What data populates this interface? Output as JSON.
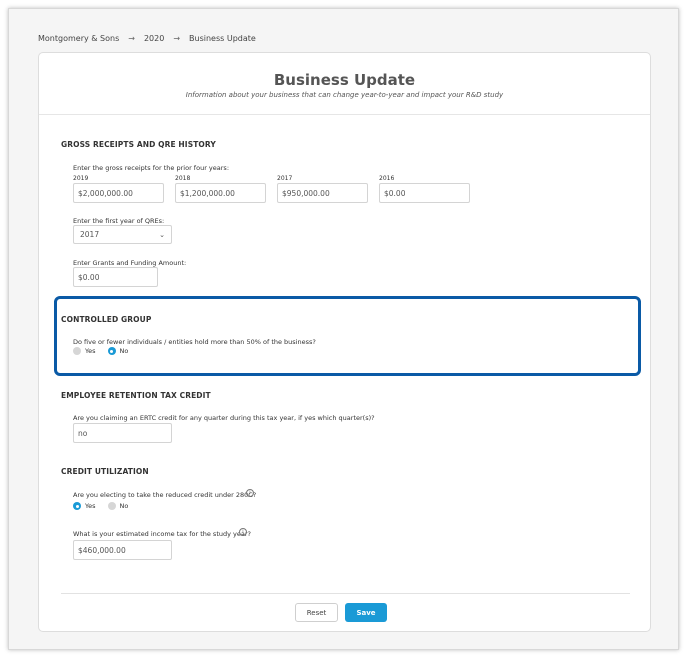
{
  "breadcrumb": {
    "items": [
      "Montgomery & Sons",
      "2020",
      "Business Update"
    ],
    "separator": "→"
  },
  "header": {
    "title": "Business Update",
    "subtitle": "Information about your business that can change year-to-year and impact your R&D study"
  },
  "gross_receipts": {
    "heading": "GROSS RECEIPTS AND QRE HISTORY",
    "prompt": "Enter the gross receipts for the prior four years:",
    "years": [
      {
        "label": "2019",
        "value": "$2,000,000.00"
      },
      {
        "label": "2018",
        "value": "$1,200,000.00"
      },
      {
        "label": "2017",
        "value": "$950,000.00"
      },
      {
        "label": "2016",
        "value": "$0.00"
      }
    ],
    "first_qre_label": "Enter the first year of QREs:",
    "first_qre_value": "2017",
    "grants_label": "Enter Grants and Funding Amount:",
    "grants_value": "$0.00"
  },
  "controlled_group": {
    "heading": "CONTROLLED GROUP",
    "question": "Do five or fewer individuals / entities hold more than 50% of the business?",
    "options": [
      "Yes",
      "No"
    ],
    "selected": "No"
  },
  "ertc": {
    "heading": "EMPLOYEE RETENTION TAX CREDIT",
    "question": "Are you claiming an ERTC credit for any quarter during this tax year, if yes which quarter(s)?",
    "value": "no"
  },
  "credit_utilization": {
    "heading": "CREDIT UTILIZATION",
    "reduced_question": "Are you electing to take the reduced credit under 280C?",
    "options": [
      "Yes",
      "No"
    ],
    "selected": "Yes",
    "income_tax_question": "What is your estimated income tax for the study year?",
    "income_tax_value": "$460,000.00"
  },
  "actions": {
    "reset_label": "Reset",
    "save_label": "Save"
  },
  "colors": {
    "accent": "#1a9ad6",
    "highlight_border": "#0a5aa6"
  },
  "icons": {
    "info": "info-icon",
    "chevron": "chevron-down-icon"
  }
}
